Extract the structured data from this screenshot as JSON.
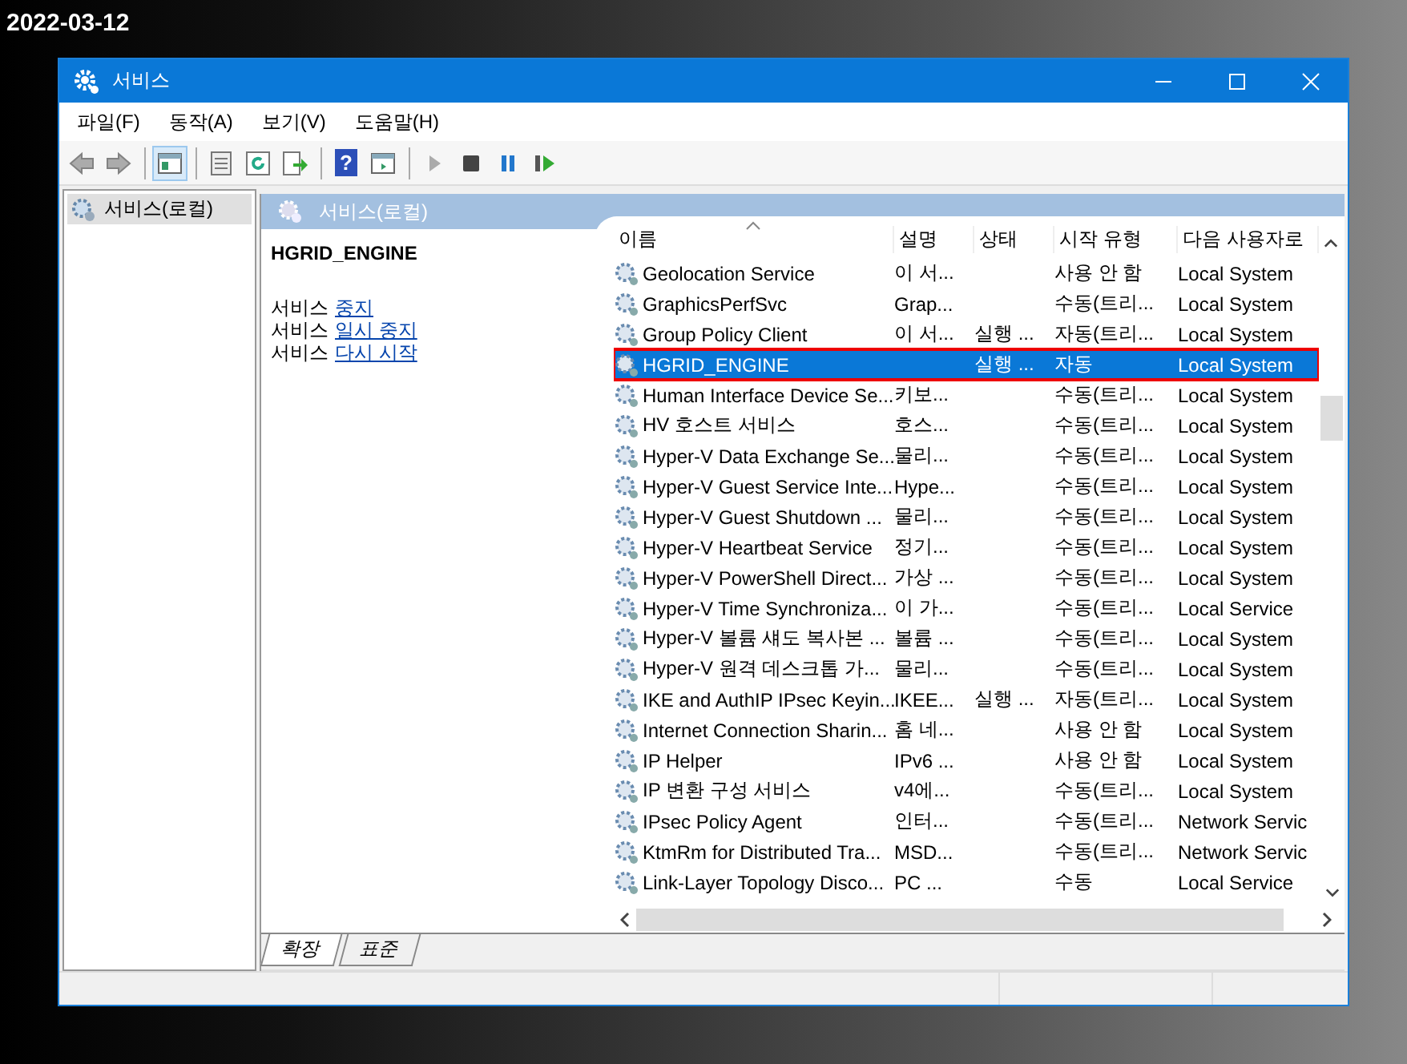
{
  "date_label": "2022-03-12",
  "window": {
    "title": "서비스"
  },
  "menu": [
    "파일(F)",
    "동작(A)",
    "보기(V)",
    "도움말(H)"
  ],
  "toolbar": [
    {
      "kind": "back",
      "disabled": true
    },
    {
      "kind": "forward",
      "disabled": true
    },
    {
      "kind": "sep"
    },
    {
      "kind": "tree",
      "selected": true
    },
    {
      "kind": "sep"
    },
    {
      "kind": "properties"
    },
    {
      "kind": "refresh"
    },
    {
      "kind": "export"
    },
    {
      "kind": "sep"
    },
    {
      "kind": "help",
      "glyph": "?"
    },
    {
      "kind": "view"
    },
    {
      "kind": "sep"
    },
    {
      "kind": "play",
      "disabled": true
    },
    {
      "kind": "stop"
    },
    {
      "kind": "pause"
    },
    {
      "kind": "resume"
    }
  ],
  "tree": [
    {
      "label": "서비스(로컬)",
      "selected": true
    }
  ],
  "panel_header": "서비스(로컬)",
  "details": {
    "title": "HGRID_ENGINE",
    "actions": [
      {
        "prefix": "서비스",
        "link": "중지"
      },
      {
        "prefix": "서비스",
        "link": "일시 중지"
      },
      {
        "prefix": "서비스",
        "link": "다시 시작"
      }
    ]
  },
  "table": {
    "columns": [
      "이름",
      "설명",
      "상태",
      "시작 유형",
      "다음 사용자로"
    ],
    "rows": [
      {
        "cells": [
          "Geolocation Service",
          "이 서...",
          "",
          "사용 안 함",
          "Local System"
        ],
        "selected": false,
        "highlighted": false
      },
      {
        "cells": [
          "GraphicsPerfSvc",
          "Grap...",
          "",
          "수동(트리...",
          "Local System"
        ],
        "selected": false,
        "highlighted": false
      },
      {
        "cells": [
          "Group Policy Client",
          "이 서...",
          "실행 ...",
          "자동(트리...",
          "Local System"
        ],
        "selected": false,
        "highlighted": false
      },
      {
        "cells": [
          "HGRID_ENGINE",
          "",
          "실행 ...",
          "자동",
          "Local System"
        ],
        "selected": true,
        "highlighted": true
      },
      {
        "cells": [
          "Human Interface Device Se...",
          "키보...",
          "",
          "수동(트리...",
          "Local System"
        ],
        "selected": false,
        "highlighted": false
      },
      {
        "cells": [
          "HV 호스트 서비스",
          "호스...",
          "",
          "수동(트리...",
          "Local System"
        ],
        "selected": false,
        "highlighted": false
      },
      {
        "cells": [
          "Hyper-V Data Exchange Se...",
          "물리...",
          "",
          "수동(트리...",
          "Local System"
        ],
        "selected": false,
        "highlighted": false
      },
      {
        "cells": [
          "Hyper-V Guest Service Inte...",
          "Hype...",
          "",
          "수동(트리...",
          "Local System"
        ],
        "selected": false,
        "highlighted": false
      },
      {
        "cells": [
          "Hyper-V Guest Shutdown ...",
          "물리...",
          "",
          "수동(트리...",
          "Local System"
        ],
        "selected": false,
        "highlighted": false
      },
      {
        "cells": [
          "Hyper-V Heartbeat Service",
          "정기...",
          "",
          "수동(트리...",
          "Local System"
        ],
        "selected": false,
        "highlighted": false
      },
      {
        "cells": [
          "Hyper-V PowerShell Direct...",
          "가상 ...",
          "",
          "수동(트리...",
          "Local System"
        ],
        "selected": false,
        "highlighted": false
      },
      {
        "cells": [
          "Hyper-V Time Synchroniza...",
          "이 가...",
          "",
          "수동(트리...",
          "Local Service"
        ],
        "selected": false,
        "highlighted": false
      },
      {
        "cells": [
          "Hyper-V 볼륨 섀도 복사본 ...",
          "볼륨 ...",
          "",
          "수동(트리...",
          "Local System"
        ],
        "selected": false,
        "highlighted": false
      },
      {
        "cells": [
          "Hyper-V 원격 데스크톱 가...",
          "물리...",
          "",
          "수동(트리...",
          "Local System"
        ],
        "selected": false,
        "highlighted": false
      },
      {
        "cells": [
          "IKE and AuthIP IPsec Keyin...",
          "IKEE...",
          "실행 ...",
          "자동(트리...",
          "Local System"
        ],
        "selected": false,
        "highlighted": false
      },
      {
        "cells": [
          "Internet Connection Sharin...",
          "홈 네...",
          "",
          "사용 안 함",
          "Local System"
        ],
        "selected": false,
        "highlighted": false
      },
      {
        "cells": [
          "IP Helper",
          "IPv6 ...",
          "",
          "사용 안 함",
          "Local System"
        ],
        "selected": false,
        "highlighted": false
      },
      {
        "cells": [
          "IP 변환 구성 서비스",
          "v4에...",
          "",
          "수동(트리...",
          "Local System"
        ],
        "selected": false,
        "highlighted": false
      },
      {
        "cells": [
          "IPsec Policy Agent",
          "인터...",
          "",
          "수동(트리...",
          "Network Servic"
        ],
        "selected": false,
        "highlighted": false
      },
      {
        "cells": [
          "KtmRm for Distributed Tra...",
          "MSD...",
          "",
          "수동(트리...",
          "Network Servic"
        ],
        "selected": false,
        "highlighted": false
      },
      {
        "cells": [
          "Link-Layer Topology Disco...",
          "PC ...",
          "",
          "수동",
          "Local Service"
        ],
        "selected": false,
        "highlighted": false
      }
    ]
  },
  "bottom_tabs": [
    {
      "label": "확장",
      "selected": true
    },
    {
      "label": "표준",
      "selected": false
    }
  ]
}
